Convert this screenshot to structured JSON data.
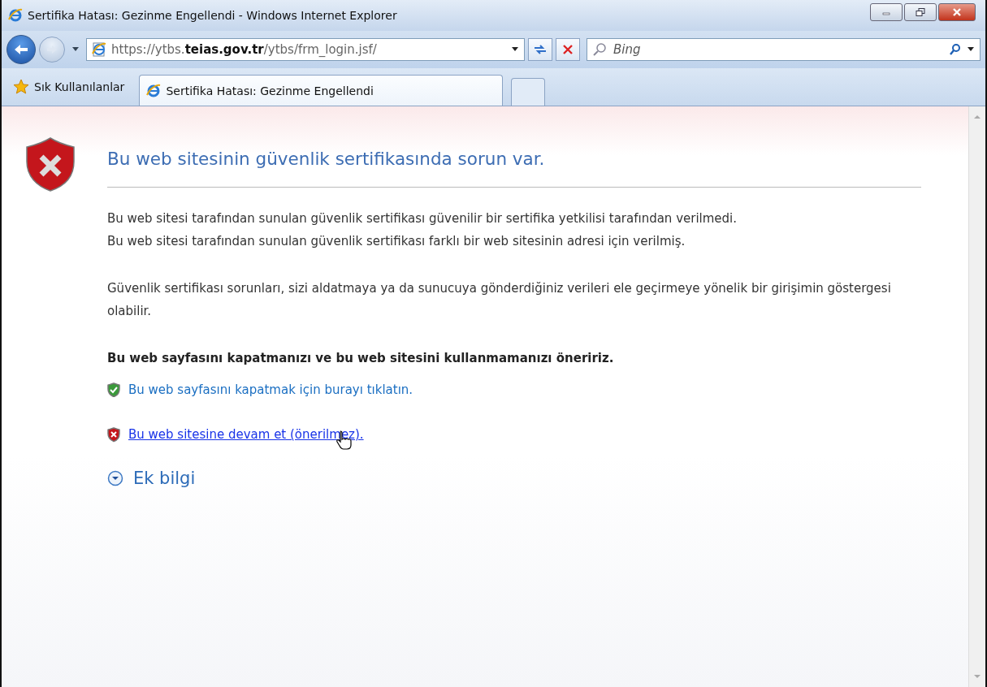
{
  "window": {
    "title": "Sertifika Hatası: Gezinme Engellendi - Windows Internet Explorer"
  },
  "address_bar": {
    "value": "https://ytbs.**teias.gov.tr**/ytbs/frm_login.jsf/"
  },
  "search": {
    "placeholder": "Bing"
  },
  "favorites": {
    "label": "Sık Kullanılanlar"
  },
  "tabs": [
    {
      "label": "Sertifika Hatası: Gezinme Engellendi",
      "selected": true
    }
  ],
  "page": {
    "heading": "Bu web sitesinin güvenlik sertifikasında sorun var.",
    "paragraphs": [
      {
        "lines": [
          "Bu web sitesi tarafından sunulan güvenlik sertifikası güvenilir bir sertifika yetkilisi tarafından verilmedi.",
          "Bu web sitesi tarafından sunulan güvenlik sertifikası farklı bir web sitesinin adresi için verilmiş."
        ]
      },
      {
        "lines": [
          "Güvenlik sertifikası sorunları, sizi aldatmaya ya da sunucuya gönderdiğiniz verileri ele geçirmeye yönelik bir girişimin göstergesi olabilir."
        ]
      }
    ],
    "recommendation": "Bu web sayfasını kapatmanızı ve bu web sitesini kullanmamanızı öneririz.",
    "links": [
      {
        "kind": "safe",
        "label": "Bu web sayfasını kapatmak için burayı tıklatın.",
        "hovered": false
      },
      {
        "kind": "unsafe",
        "label": "Bu web sitesine devam et (önerilmez).",
        "hovered": true
      }
    ],
    "more_info": {
      "label": "Ek bilgi",
      "expanded": false
    }
  }
}
